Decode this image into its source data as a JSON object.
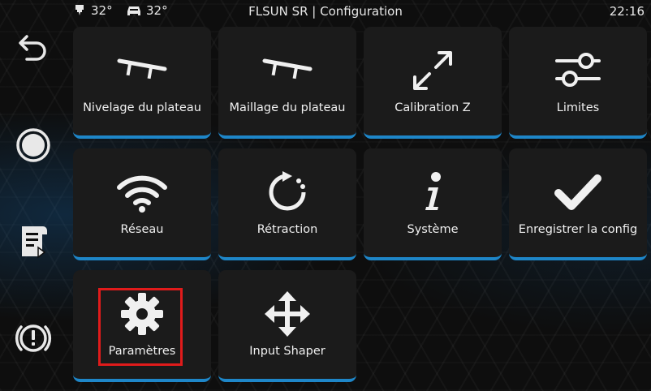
{
  "status_bar": {
    "extruder_temp": "32°",
    "bed_temp": "32°",
    "title": "FLSUN SR | Configuration",
    "clock": "22:16"
  },
  "sidebar": {
    "items": [
      {
        "name": "back",
        "icon": "back-arrow-icon"
      },
      {
        "name": "home",
        "icon": "circle-icon"
      },
      {
        "name": "print-files",
        "icon": "scroll-icon"
      },
      {
        "name": "emergency-stop",
        "icon": "emergency-stop-icon"
      }
    ]
  },
  "menu": {
    "tiles": [
      {
        "label": "Nivelage du plateau",
        "icon": "bed-level-icon"
      },
      {
        "label": "Maillage du plateau",
        "icon": "bed-mesh-icon"
      },
      {
        "label": "Calibration Z",
        "icon": "expand-arrows-icon"
      },
      {
        "label": "Limites",
        "icon": "sliders-icon"
      },
      {
        "label": "Réseau",
        "icon": "wifi-icon"
      },
      {
        "label": "Rétraction",
        "icon": "retraction-icon"
      },
      {
        "label": "Système",
        "icon": "info-icon"
      },
      {
        "label": "Enregistrer la config",
        "icon": "checkmark-icon"
      },
      {
        "label": "Paramètres",
        "icon": "gear-icon"
      },
      {
        "label": "Input Shaper",
        "icon": "move-arrows-icon"
      }
    ],
    "highlighted": "Paramètres"
  },
  "colors": {
    "accent": "#1e86c8",
    "tile_bg": "#1b1b1b",
    "highlight": "#e01b1b"
  }
}
